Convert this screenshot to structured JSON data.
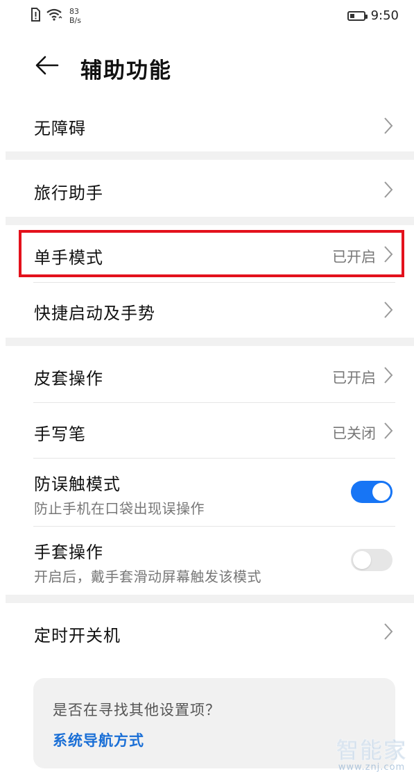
{
  "status_bar": {
    "net_speed_value": "83",
    "net_speed_unit": "B/s",
    "battery_level": 0.35,
    "time": "9:50"
  },
  "header": {
    "title": "辅助功能"
  },
  "rows": {
    "accessibility": {
      "label": "无障碍"
    },
    "travel_assistant": {
      "label": "旅行助手"
    },
    "one_hand_mode": {
      "label": "单手模式",
      "value": "已开启"
    },
    "shortcuts_gestures": {
      "label": "快捷启动及手势"
    },
    "cover_operation": {
      "label": "皮套操作",
      "value": "已开启"
    },
    "stylus": {
      "label": "手写笔",
      "value": "已关闭"
    },
    "accidental_touch": {
      "label": "防误触模式",
      "subtitle": "防止手机在口袋出现误操作",
      "enabled": true
    },
    "glove_mode": {
      "label": "手套操作",
      "subtitle": "开启后，戴手套滑动屏幕触发该模式",
      "enabled": false
    },
    "scheduled_power": {
      "label": "定时开关机"
    }
  },
  "suggestion": {
    "question": "是否在寻找其他设置项？",
    "link": "系统导航方式"
  },
  "watermark": {
    "main": "智能家",
    "sub": "www.znj.com"
  },
  "colors": {
    "accent": "#1775f5",
    "highlight": "#e3111c",
    "link": "#1a6fd6"
  }
}
